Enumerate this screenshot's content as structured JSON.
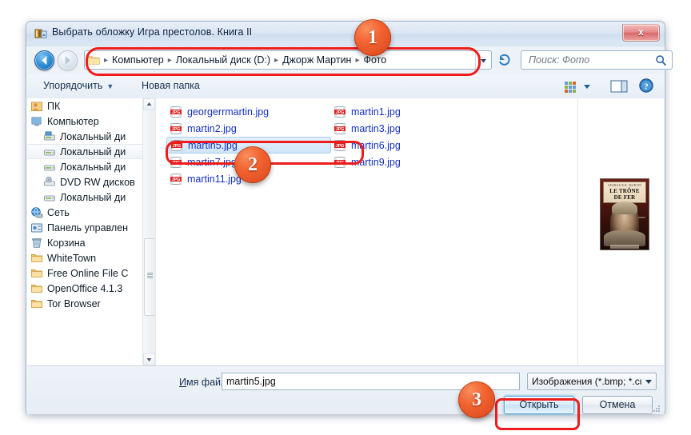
{
  "window": {
    "title": "Выбрать обложку Игра престолов. Книга II",
    "title_icon": "folder-picture-icon",
    "close_label": "x"
  },
  "nav": {
    "back_icon": "back-arrow-icon",
    "forward_icon": "forward-arrow-icon",
    "refresh_icon": "refresh-icon",
    "dropdown_icon": "chevron-down-icon",
    "breadcrumbs": [
      "Компьютер",
      "Локальный диск (D:)",
      "Джорж Мартин",
      "Фото"
    ],
    "separator": "▸"
  },
  "search": {
    "placeholder": "Поиск: Фото",
    "icon": "search-icon"
  },
  "toolbar": {
    "organize": "Упорядочить",
    "organize_caret": "▼",
    "new_folder": "Новая папка",
    "view_icon": "view-mode-icon",
    "pane_icon": "preview-pane-icon",
    "help_icon": "help-icon"
  },
  "sidebar": {
    "items": [
      {
        "label": "ПК",
        "icon": "user-folder-icon",
        "indent": 1,
        "selected": false
      },
      {
        "label": "Компьютер",
        "icon": "computer-icon",
        "indent": 1,
        "selected": false
      },
      {
        "label": "Локальный ди",
        "icon": "system-drive-icon",
        "indent": 2,
        "selected": false
      },
      {
        "label": "Локальный ди",
        "icon": "drive-icon",
        "indent": 2,
        "selected": true
      },
      {
        "label": "Локальный ди",
        "icon": "drive-icon",
        "indent": 2,
        "selected": false
      },
      {
        "label": "DVD RW дисков",
        "icon": "dvd-drive-icon",
        "indent": 2,
        "selected": false
      },
      {
        "label": "Локальный ди",
        "icon": "drive-icon",
        "indent": 2,
        "selected": false
      },
      {
        "label": "Сеть",
        "icon": "network-icon",
        "indent": 1,
        "selected": false
      },
      {
        "label": "Панель управлен",
        "icon": "control-panel-icon",
        "indent": 1,
        "selected": false
      },
      {
        "label": "Корзина",
        "icon": "recycle-bin-icon",
        "indent": 1,
        "selected": false
      },
      {
        "label": "WhiteTown",
        "icon": "folder-icon",
        "indent": 1,
        "selected": false
      },
      {
        "label": "Free Online File C",
        "icon": "folder-icon",
        "indent": 1,
        "selected": false
      },
      {
        "label": "OpenOffice 4.1.3",
        "icon": "folder-icon",
        "indent": 1,
        "selected": false
      },
      {
        "label": "Tor Browser",
        "icon": "folder-icon",
        "indent": 1,
        "selected": false
      }
    ]
  },
  "files": {
    "column1": [
      {
        "name": "georgerrmartin.jpg",
        "icon": "jpg-file-icon",
        "selected": false
      },
      {
        "name": "martin2.jpg",
        "icon": "jpg-file-icon",
        "selected": false
      },
      {
        "name": "martin5.jpg",
        "icon": "jpg-file-icon",
        "selected": true
      },
      {
        "name": "martin7.jpg",
        "icon": "jpg-file-icon",
        "selected": false
      },
      {
        "name": "martin11.jpg",
        "icon": "jpg-file-icon",
        "selected": false
      }
    ],
    "column2": [
      {
        "name": "martin1.jpg",
        "icon": "jpg-file-icon",
        "selected": false
      },
      {
        "name": "martin3.jpg",
        "icon": "jpg-file-icon",
        "selected": false
      },
      {
        "name": "martin6.jpg",
        "icon": "jpg-file-icon",
        "selected": false
      },
      {
        "name": "martin9.jpg",
        "icon": "jpg-file-icon",
        "selected": false
      }
    ]
  },
  "preview": {
    "cover_author": "GEORGE R.R. MARTIN",
    "cover_title_line1": "LE TRÔNE",
    "cover_title_line2": "DE FER",
    "cover_roman": "roman"
  },
  "footer": {
    "filename_label": "Имя файла:",
    "filename_value": "martin5.jpg",
    "filter_value": "Изображения (*.bmp; *.cur; *.c",
    "open_label": "Открыть",
    "cancel_label": "Отмена"
  },
  "annotations": {
    "badge1": "1",
    "badge2": "2",
    "badge3": "3",
    "accent_color": "#ee1c1c",
    "badge_color": "#f26430"
  }
}
